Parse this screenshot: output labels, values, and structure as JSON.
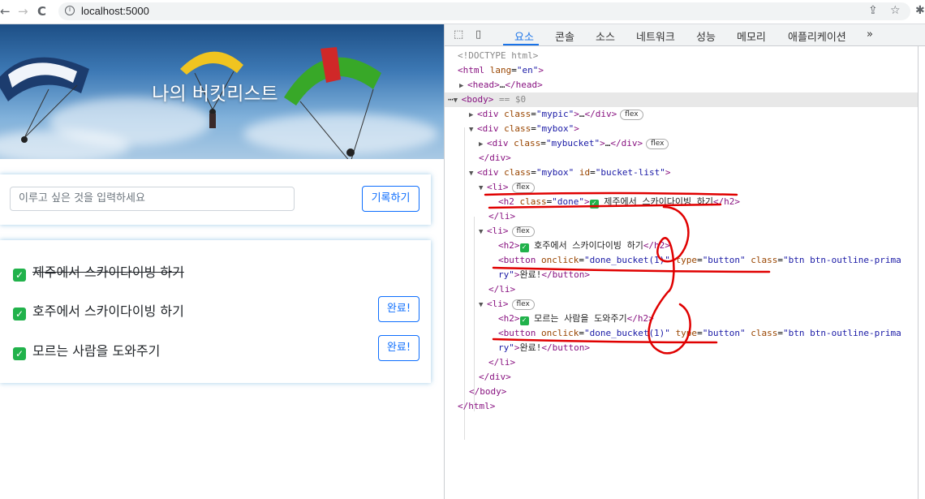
{
  "browser": {
    "url": "localhost:5000",
    "back_glyph": "←",
    "forward_glyph": "→",
    "reload_glyph": "C"
  },
  "page": {
    "title": "나의 버킷리스트",
    "input_placeholder": "이루고 싶은 것을 입력하세요",
    "record_button": "기록하기",
    "items": [
      {
        "text": "제주에서 스카이다이빙 하기",
        "done": true
      },
      {
        "text": "호주에서 스카이다이빙 하기",
        "done": false,
        "button": "완료!"
      },
      {
        "text": "모르는 사람을 도와주기",
        "done": false,
        "button": "완료!"
      }
    ]
  },
  "devtools": {
    "tabs": [
      "요소",
      "콘솔",
      "소스",
      "네트워크",
      "성능",
      "메모리",
      "애플리케이션",
      "»"
    ],
    "active_tab": "요소",
    "badge": "flex",
    "eq": "== $0"
  },
  "colors": {
    "accent": "#0d6efd",
    "check": "#21b24b",
    "annotation": "#e00000"
  },
  "icons": [
    "back-icon",
    "forward-icon",
    "reload-icon",
    "info-icon",
    "share-icon",
    "star-icon",
    "inspect-icon",
    "device-icon",
    "check-icon"
  ]
}
